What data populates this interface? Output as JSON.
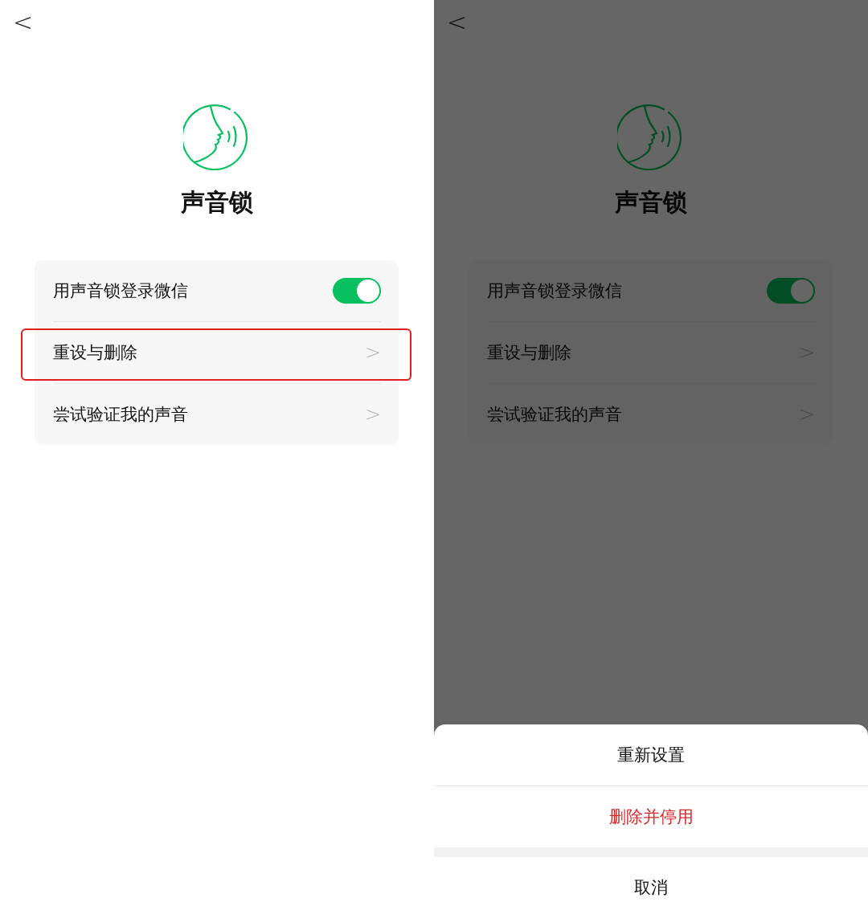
{
  "screens": [
    {
      "back": "<",
      "title": "声音锁",
      "settings": [
        {
          "kind": "toggle",
          "label": "用声音锁登录微信",
          "on": true,
          "highlighted": false
        },
        {
          "kind": "link",
          "label": "重设与删除",
          "chevron": ">",
          "highlighted": true
        },
        {
          "kind": "link",
          "label": "尝试验证我的声音",
          "chevron": ">",
          "highlighted": false
        }
      ]
    },
    {
      "back": "<",
      "title": "声音锁",
      "settings": [
        {
          "kind": "toggle",
          "label": "用声音锁登录微信",
          "on": true,
          "highlighted": false
        },
        {
          "kind": "link",
          "label": "重设与删除",
          "chevron": ">",
          "highlighted": false
        },
        {
          "kind": "link",
          "label": "尝试验证我的声音",
          "chevron": ">",
          "highlighted": false
        }
      ],
      "action_sheet": {
        "actions": [
          {
            "label": "重新设置",
            "kind": "normal"
          },
          {
            "label": "删除并停用",
            "kind": "destructive"
          }
        ],
        "cancel": "取消"
      }
    }
  ]
}
